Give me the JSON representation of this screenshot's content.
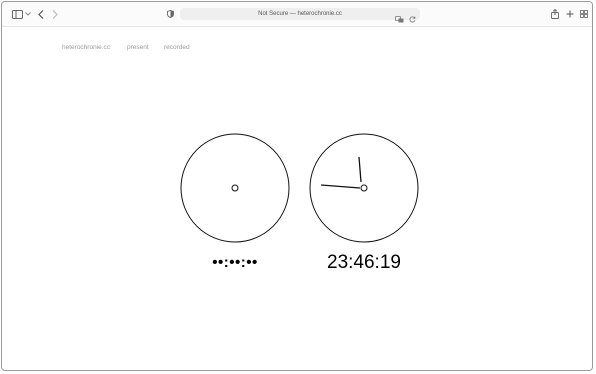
{
  "browser": {
    "address": "Not Secure — heterochronie.cc"
  },
  "nav": {
    "items": [
      {
        "label": "heterochronie.cc"
      },
      {
        "label": "present"
      },
      {
        "label": "recorded"
      }
    ]
  },
  "clocks": {
    "left": {
      "readout": "••:••:••"
    },
    "right": {
      "readout": "23:46:19"
    }
  }
}
